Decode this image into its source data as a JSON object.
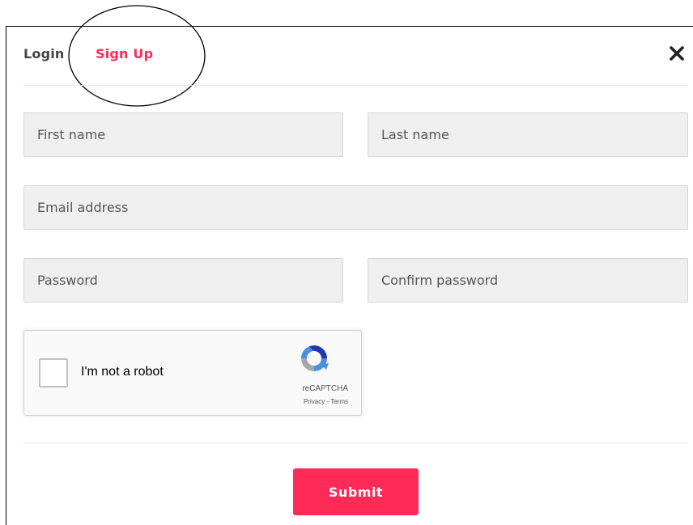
{
  "header": {
    "tabs": [
      {
        "label": "Login",
        "active": false
      },
      {
        "label": "Sign Up",
        "active": true
      }
    ],
    "close_icon": "close-icon"
  },
  "form": {
    "first_name": {
      "placeholder": "First name",
      "value": ""
    },
    "last_name": {
      "placeholder": "Last name",
      "value": ""
    },
    "email": {
      "placeholder": "Email address",
      "value": ""
    },
    "password": {
      "placeholder": "Password",
      "value": ""
    },
    "confirm_password": {
      "placeholder": "Confirm password",
      "value": ""
    },
    "submit_label": "Submit"
  },
  "recaptcha": {
    "label": "I'm not a robot",
    "brand": "reCAPTCHA",
    "privacy": "Privacy",
    "separator": " - ",
    "terms": "Terms",
    "checked": false,
    "logo_icon": "recaptcha-logo-icon"
  },
  "colors": {
    "accent": "#ff2b56",
    "input_bg": "#efefef",
    "text_dark": "#444444"
  }
}
